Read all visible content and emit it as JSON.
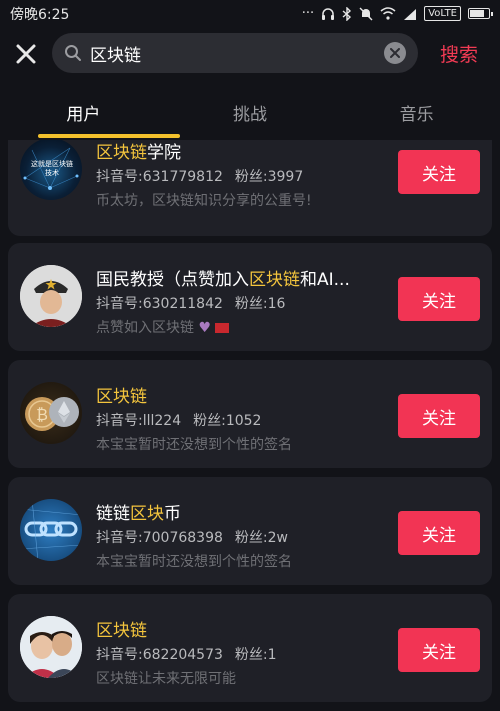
{
  "status_bar": {
    "time": "傍晚6:25",
    "network": "VoLTE"
  },
  "search": {
    "query": "区块链",
    "submit_label": "搜索"
  },
  "tabs": [
    {
      "label": "用户",
      "active": true
    },
    {
      "label": "挑战",
      "active": false
    },
    {
      "label": "音乐",
      "active": false
    }
  ],
  "colors": {
    "accent": "#f23454",
    "highlight": "#f4c53d",
    "tab_indicator": "#f3c12c"
  },
  "users": [
    {
      "name_parts": [
        {
          "t": "区块链",
          "hl": true
        },
        {
          "t": "学院",
          "hl": false
        }
      ],
      "id_label": "抖音号:631779812",
      "fans_label": "粉丝:3997",
      "signature": "币太坊，区块链知识分享的公重号!",
      "avatar_text": "这就是区块链技术",
      "follow_label": "关注"
    },
    {
      "name_parts": [
        {
          "t": "国民教授（点赞加入",
          "hl": false
        },
        {
          "t": "区块链",
          "hl": true
        },
        {
          "t": "和AI...",
          "hl": false
        }
      ],
      "id_label": "抖音号:630211842",
      "fans_label": "粉丝:16",
      "signature": "点赞如入区块链",
      "avatar_text": "",
      "follow_label": "关注"
    },
    {
      "name_parts": [
        {
          "t": "区块链",
          "hl": true
        }
      ],
      "id_label": "抖音号:lll224",
      "fans_label": "粉丝:1052",
      "signature": "本宝宝暂时还没想到个性的签名",
      "avatar_text": "",
      "follow_label": "关注"
    },
    {
      "name_parts": [
        {
          "t": "链链",
          "hl": false
        },
        {
          "t": "区块",
          "hl": true
        },
        {
          "t": "币",
          "hl": false
        }
      ],
      "id_label": "抖音号:700768398",
      "fans_label": "粉丝:2w",
      "signature": "本宝宝暂时还没想到个性的签名",
      "avatar_text": "",
      "follow_label": "关注"
    },
    {
      "name_parts": [
        {
          "t": "区块链",
          "hl": true
        }
      ],
      "id_label": "抖音号:682204573",
      "fans_label": "粉丝:1",
      "signature": "区块链让未来无限可能",
      "avatar_text": "",
      "follow_label": "关注"
    }
  ]
}
